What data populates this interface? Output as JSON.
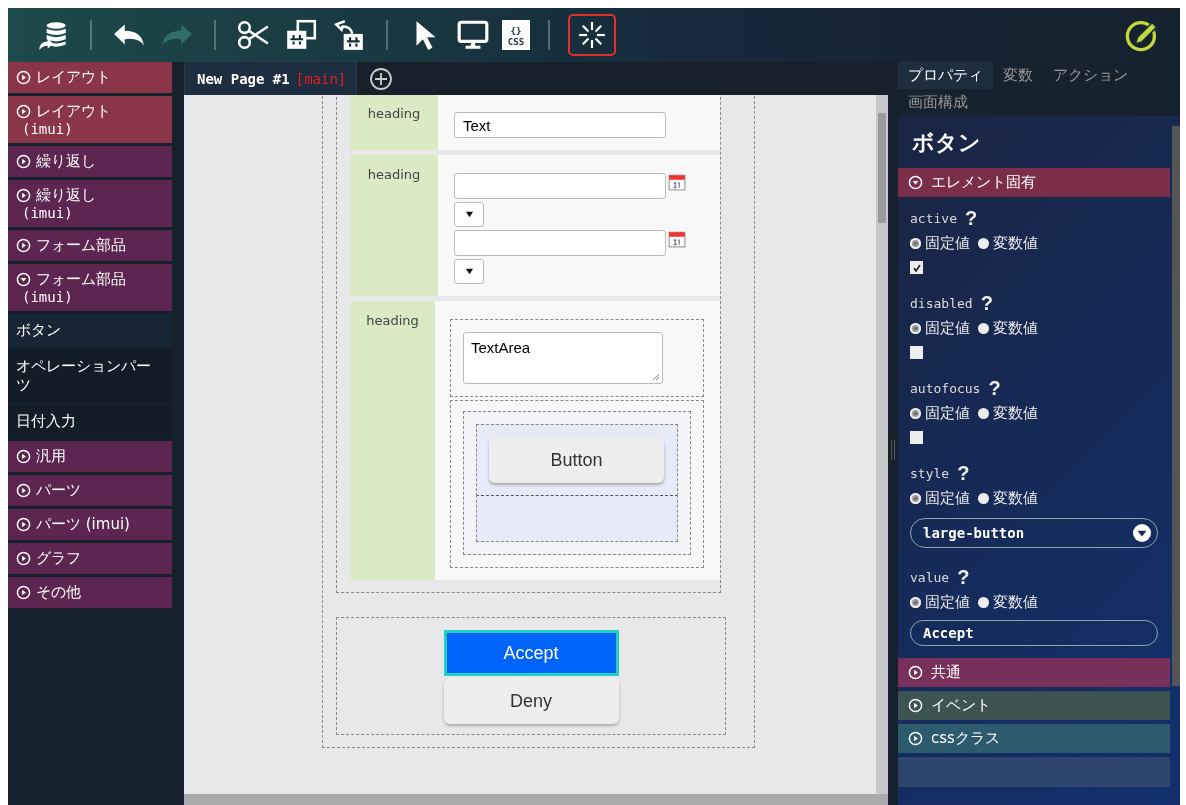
{
  "toolbar": {
    "tools": [
      {
        "kind": "database"
      },
      {
        "kind": "separator"
      },
      {
        "kind": "undo",
        "disabled": false
      },
      {
        "kind": "redo",
        "disabled": true
      },
      {
        "kind": "separator"
      },
      {
        "kind": "cut"
      },
      {
        "kind": "copy"
      },
      {
        "kind": "paste"
      },
      {
        "kind": "separator"
      },
      {
        "kind": "pointer"
      },
      {
        "kind": "monitor"
      },
      {
        "kind": "css",
        "braces": "{}",
        "label": "CSS"
      },
      {
        "kind": "separator"
      },
      {
        "kind": "spinner",
        "selected": true
      }
    ]
  },
  "sidebar": {
    "items": [
      {
        "kind": "group",
        "label": "レイアウト",
        "expanded": false,
        "color": "#8a3548"
      },
      {
        "kind": "group",
        "label": "レイアウト",
        "sub": "(imui)",
        "expanded": false,
        "color": "#8a3548"
      },
      {
        "kind": "group",
        "label": "繰り返し",
        "expanded": false,
        "color": "#5c2650"
      },
      {
        "kind": "group",
        "label": "繰り返し",
        "sub": "(imui)",
        "expanded": false,
        "color": "#5c2650"
      },
      {
        "kind": "group",
        "label": "フォーム部品",
        "expanded": false,
        "color": "#5c2650"
      },
      {
        "kind": "group",
        "label": "フォーム部品",
        "sub": "(imui)",
        "expanded": true,
        "color": "#5c2650"
      },
      {
        "kind": "item",
        "label": "ボタン",
        "selected": true
      },
      {
        "kind": "item",
        "label": "オペレーションパーツ",
        "selected": false
      },
      {
        "kind": "item",
        "label": "日付入力",
        "selected": false
      },
      {
        "kind": "group",
        "label": "汎用",
        "expanded": false,
        "color": "#5c2650"
      },
      {
        "kind": "group",
        "label": "パーツ",
        "expanded": false,
        "color": "#5c2650"
      },
      {
        "kind": "group",
        "label": "パーツ (imui)",
        "expanded": false,
        "color": "#5c2650"
      },
      {
        "kind": "group",
        "label": "グラフ",
        "expanded": false,
        "color": "#5c2650"
      },
      {
        "kind": "group",
        "label": "その他",
        "expanded": false,
        "color": "#5c2650"
      }
    ]
  },
  "page_tabs": [
    {
      "label": "New Page #1",
      "tag": "[main]",
      "selected": true
    }
  ],
  "form": {
    "rows": [
      {
        "heading": "heading",
        "kind": "text",
        "value": "Text"
      },
      {
        "heading": "heading",
        "kind": "date_range"
      },
      {
        "heading": "heading",
        "kind": "textarea_button",
        "textarea": "TextArea",
        "button": "Button"
      }
    ]
  },
  "actions": [
    {
      "label": "Accept",
      "selected": true
    },
    {
      "label": "Deny",
      "selected": false
    }
  ],
  "panel": {
    "tabs": [
      {
        "label": "プロパティ",
        "selected": true
      },
      {
        "label": "変数",
        "selected": false
      },
      {
        "label": "アクション",
        "selected": false
      },
      {
        "label": "画面構成",
        "selected": false
      }
    ],
    "title": "ボタン",
    "sections": [
      {
        "label": "エレメント固有",
        "expanded": true,
        "color": "#7a2e4a",
        "properties": [
          {
            "name": "active",
            "help": "?",
            "kind": "checkbox",
            "checked": true,
            "options": [
              {
                "label": "固定値",
                "selected": true
              },
              {
                "label": "変数値",
                "selected": false
              }
            ]
          },
          {
            "name": "disabled",
            "help": "?",
            "kind": "checkbox",
            "checked": false,
            "options": [
              {
                "label": "固定値",
                "selected": true
              },
              {
                "label": "変数値",
                "selected": false
              }
            ]
          },
          {
            "name": "autofocus",
            "help": "?",
            "kind": "checkbox",
            "checked": false,
            "options": [
              {
                "label": "固定値",
                "selected": true
              },
              {
                "label": "変数値",
                "selected": false
              }
            ]
          },
          {
            "name": "style",
            "help": "?",
            "kind": "select",
            "value": "large-button",
            "options": [
              {
                "label": "固定値",
                "selected": true
              },
              {
                "label": "変数値",
                "selected": false
              }
            ]
          },
          {
            "name": "value",
            "help": "?",
            "kind": "text",
            "value": "Accept",
            "options": [
              {
                "label": "固定値",
                "selected": true
              },
              {
                "label": "変数値",
                "selected": false
              }
            ]
          }
        ]
      },
      {
        "label": "共通",
        "expanded": false,
        "color": "#76305a"
      },
      {
        "label": "イベント",
        "expanded": false,
        "color": "#3e5450"
      },
      {
        "label": "cssクラス",
        "expanded": false,
        "color": "#2e5a6e"
      }
    ]
  }
}
